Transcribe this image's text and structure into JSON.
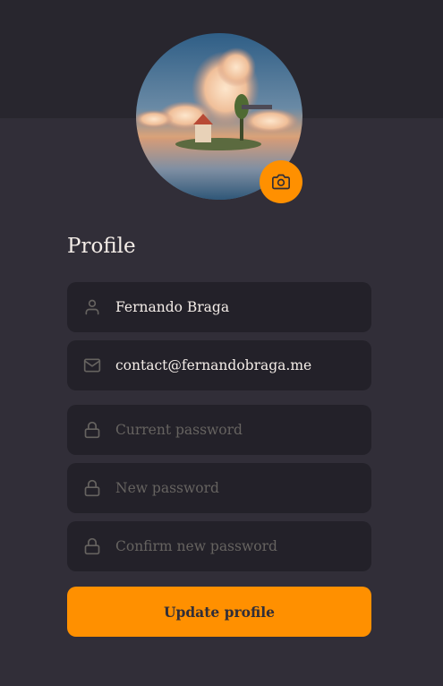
{
  "profile": {
    "title": "Profile",
    "avatar_alt": "Fernando Braga avatar",
    "fields": {
      "name": {
        "value": "Fernando Braga",
        "icon": "user-icon"
      },
      "email": {
        "value": "contact@fernandobraga.me",
        "icon": "mail-icon"
      },
      "current_password": {
        "placeholder": "Current password",
        "icon": "lock-icon"
      },
      "new_password": {
        "placeholder": "New password",
        "icon": "lock-icon"
      },
      "confirm_password": {
        "placeholder": "Confirm new password",
        "icon": "lock-icon"
      }
    },
    "submit_label": "Update profile"
  },
  "colors": {
    "background": "#312e38",
    "header": "#28262e",
    "input_bg": "#232129",
    "accent": "#ff9000",
    "text": "#f4ede8",
    "placeholder": "#666360"
  }
}
